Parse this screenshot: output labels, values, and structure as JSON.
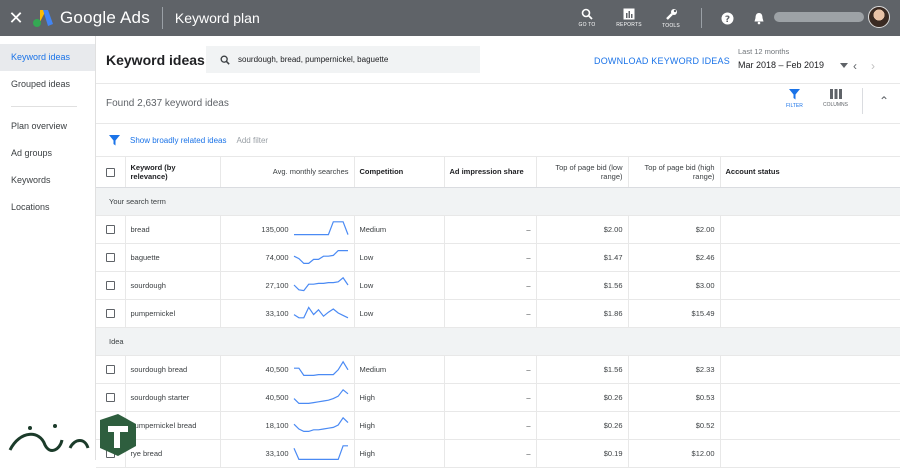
{
  "topbar": {
    "app_name": "Google Ads",
    "page_title": "Keyword plan",
    "tools": [
      {
        "label": "GO TO",
        "icon": "search-icon"
      },
      {
        "label": "REPORTS",
        "icon": "reports-icon"
      },
      {
        "label": "TOOLS",
        "icon": "wrench-icon"
      }
    ]
  },
  "sidebar": {
    "items": [
      {
        "label": "Keyword ideas",
        "active": true
      },
      {
        "label": "Grouped ideas"
      },
      {
        "label": "Plan overview"
      },
      {
        "label": "Ad groups"
      },
      {
        "label": "Keywords"
      },
      {
        "label": "Locations"
      }
    ]
  },
  "header": {
    "title": "Keyword ideas",
    "search_value": "sourdough, bread, pumpernickel, baguette",
    "download_label": "DOWNLOAD KEYWORD IDEAS",
    "date_label": "Last 12 months",
    "date_range": "Mar 2018 – Feb 2019"
  },
  "found": {
    "text": "Found 2,637 keyword ideas",
    "filter_label": "FILTER",
    "columns_label": "COLUMNS"
  },
  "filterbar": {
    "link": "Show broadly related ideas",
    "add_filter": "Add filter"
  },
  "table": {
    "headers": {
      "keyword": "Keyword (by relevance)",
      "searches": "Avg. monthly searches",
      "competition": "Competition",
      "impression": "Ad impression share",
      "bid_low": "Top of page bid (low range)",
      "bid_high": "Top of page bid (high range)",
      "status": "Account status"
    },
    "sections": [
      {
        "label": "Your search term",
        "rows": [
          {
            "keyword": "bread",
            "searches": "135,000",
            "competition": "Medium",
            "impression": "–",
            "bid_low": "$2.00",
            "bid_high": "$2.00",
            "trend": [
              0.15,
              0.15,
              0.15,
              0.15,
              0.15,
              0.15,
              0.15,
              0.15,
              0.95,
              0.95,
              0.95,
              0.15
            ]
          },
          {
            "keyword": "baguette",
            "searches": "74,000",
            "competition": "Low",
            "impression": "–",
            "bid_low": "$1.47",
            "bid_high": "$2.46",
            "trend": [
              0.55,
              0.4,
              0.1,
              0.1,
              0.35,
              0.35,
              0.55,
              0.55,
              0.6,
              0.9,
              0.9,
              0.9
            ]
          },
          {
            "keyword": "sourdough",
            "searches": "27,100",
            "competition": "Low",
            "impression": "–",
            "bid_low": "$1.56",
            "bid_high": "$3.00",
            "trend": [
              0.5,
              0.2,
              0.15,
              0.55,
              0.55,
              0.6,
              0.6,
              0.65,
              0.65,
              0.7,
              0.95,
              0.5
            ]
          },
          {
            "keyword": "pumpernickel",
            "searches": "33,100",
            "competition": "Low",
            "impression": "–",
            "bid_low": "$1.86",
            "bid_high": "$15.49",
            "trend": [
              0.4,
              0.2,
              0.2,
              0.85,
              0.4,
              0.7,
              0.3,
              0.55,
              0.75,
              0.5,
              0.35,
              0.2
            ]
          }
        ]
      },
      {
        "label": "Idea",
        "rows": [
          {
            "keyword": "sourdough bread",
            "searches": "40,500",
            "competition": "Medium",
            "impression": "–",
            "bid_low": "$1.56",
            "bid_high": "$2.33",
            "trend": [
              0.55,
              0.55,
              0.1,
              0.1,
              0.1,
              0.15,
              0.15,
              0.15,
              0.15,
              0.45,
              0.95,
              0.45
            ]
          },
          {
            "keyword": "sourdough starter",
            "searches": "40,500",
            "competition": "High",
            "impression": "–",
            "bid_low": "$0.26",
            "bid_high": "$0.53",
            "trend": [
              0.4,
              0.1,
              0.1,
              0.1,
              0.15,
              0.2,
              0.25,
              0.3,
              0.4,
              0.55,
              0.95,
              0.7
            ]
          },
          {
            "keyword": "pumpernickel bread",
            "searches": "18,100",
            "competition": "High",
            "impression": "–",
            "bid_low": "$0.26",
            "bid_high": "$0.52",
            "trend": [
              0.55,
              0.25,
              0.1,
              0.1,
              0.2,
              0.2,
              0.25,
              0.3,
              0.35,
              0.5,
              0.95,
              0.65
            ]
          },
          {
            "keyword": "rye bread",
            "searches": "33,100",
            "competition": "High",
            "impression": "–",
            "bid_low": "$0.19",
            "bid_high": "$12.00",
            "trend": [
              0.8,
              0.1,
              0.1,
              0.1,
              0.1,
              0.1,
              0.1,
              0.1,
              0.1,
              0.1,
              0.95,
              0.95
            ]
          }
        ]
      }
    ]
  },
  "colors": {
    "accent": "#1a73e8",
    "topbar": "#5f6368",
    "sparkline": "#4a8af4"
  }
}
